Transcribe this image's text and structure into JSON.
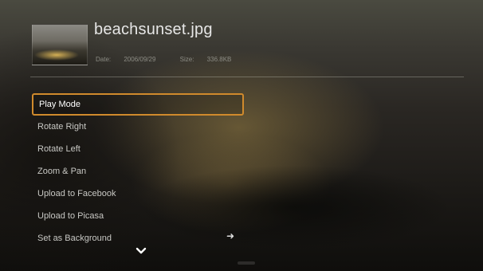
{
  "file": {
    "name": "beachsunset.jpg",
    "date_label": "Date:",
    "date_value": "2006/09/29",
    "size_label": "Size:",
    "size_value": "336.8KB"
  },
  "menu": {
    "items": [
      {
        "label": "Play Mode",
        "selected": true
      },
      {
        "label": "Rotate Right"
      },
      {
        "label": "Rotate Left"
      },
      {
        "label": "Zoom & Pan"
      },
      {
        "label": "Upload to Facebook"
      },
      {
        "label": "Upload to Picasa"
      },
      {
        "label": "Set as Background"
      }
    ]
  },
  "icons": {
    "submenu_arrow": "arrow-right-icon",
    "scroll_more": "chevron-down-icon"
  },
  "colors": {
    "selection_border": "#d08a2c",
    "text": "#c8c8c4"
  }
}
